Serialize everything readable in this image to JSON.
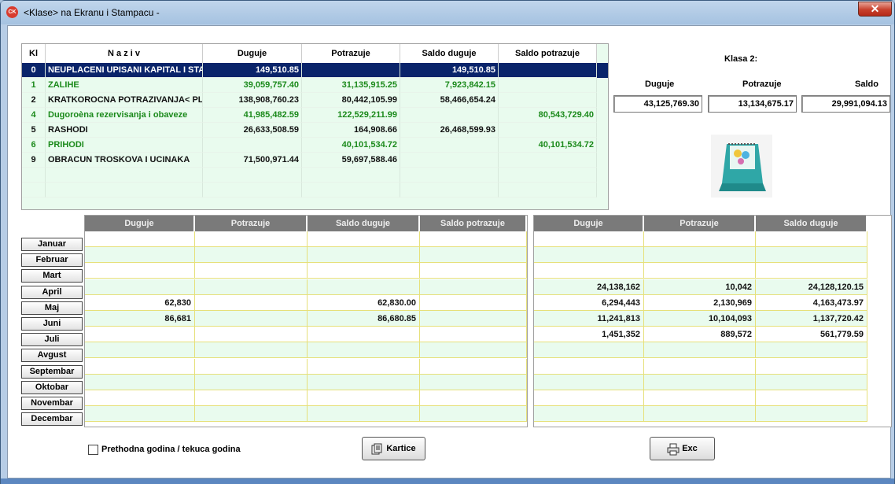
{
  "window": {
    "title": "<Klase> na Ekranu i Stampacu -",
    "icon_text": "CK",
    "close_label": "✕"
  },
  "klase_table": {
    "headers": [
      "Kl",
      "N a z i v",
      "Duguje",
      "Potrazuje",
      "Saldo duguje",
      "Saldo potrazuje"
    ],
    "rows": [
      {
        "kl": "0",
        "naziv": "NEUPLACENI UPISANI KAPITAL I STA",
        "duguje": "149,510.85",
        "potrazuje": "",
        "saldo_duguje": "149,510.85",
        "saldo_potrazuje": "",
        "color": "selected"
      },
      {
        "kl": "1",
        "naziv": "ZALIHE",
        "duguje": "39,059,757.40",
        "potrazuje": "31,135,915.25",
        "saldo_duguje": "7,923,842.15",
        "saldo_potrazuje": "",
        "color": "green"
      },
      {
        "kl": "2",
        "naziv": "KRATKOROCNA POTRAZIVANJA< PL",
        "duguje": "138,908,760.23",
        "potrazuje": "80,442,105.99",
        "saldo_duguje": "58,466,654.24",
        "saldo_potrazuje": "",
        "color": "black"
      },
      {
        "kl": "4",
        "naziv": "Dugoroèna rezervisanja i obaveze",
        "duguje": "41,985,482.59",
        "potrazuje": "122,529,211.99",
        "saldo_duguje": "",
        "saldo_potrazuje": "80,543,729.40",
        "color": "green"
      },
      {
        "kl": "5",
        "naziv": "RASHODI",
        "duguje": "26,633,508.59",
        "potrazuje": "164,908.66",
        "saldo_duguje": "26,468,599.93",
        "saldo_potrazuje": "",
        "color": "black"
      },
      {
        "kl": "6",
        "naziv": "PRIHODI",
        "duguje": "",
        "potrazuje": "40,101,534.72",
        "saldo_duguje": "",
        "saldo_potrazuje": "40,101,534.72",
        "color": "green"
      },
      {
        "kl": "9",
        "naziv": "OBRACUN TROSKOVA I UCINAKA",
        "duguje": "71,500,971.44",
        "potrazuje": "59,697,588.46",
        "saldo_duguje": "",
        "saldo_potrazuje": "",
        "color": "black"
      }
    ]
  },
  "klasa_summary": {
    "title": "Klasa 2:",
    "labels": {
      "duguje": "Duguje",
      "potrazuje": "Potrazuje",
      "saldo": "Saldo"
    },
    "values": {
      "duguje": "43,125,769.30",
      "potrazuje": "13,134,675.17",
      "saldo": "29,991,094.13"
    }
  },
  "months": [
    "Januar",
    "Februar",
    "Mart",
    "April",
    "Maj",
    "Juni",
    "Juli",
    "Avgust",
    "Septembar",
    "Oktobar",
    "Novembar",
    "Decembar"
  ],
  "prev_year_grid": {
    "headers": [
      "Duguje",
      "Potrazuje",
      "Saldo duguje",
      "Saldo potrazuje"
    ],
    "rows": [
      [
        "",
        "",
        "",
        ""
      ],
      [
        "",
        "",
        "",
        ""
      ],
      [
        "",
        "",
        "",
        ""
      ],
      [
        "",
        "",
        "",
        ""
      ],
      [
        "62,830",
        "",
        "62,830.00",
        ""
      ],
      [
        "86,681",
        "",
        "86,680.85",
        ""
      ],
      [
        "",
        "",
        "",
        ""
      ],
      [
        "",
        "",
        "",
        ""
      ],
      [
        "",
        "",
        "",
        ""
      ],
      [
        "",
        "",
        "",
        ""
      ],
      [
        "",
        "",
        "",
        ""
      ],
      [
        "",
        "",
        "",
        ""
      ]
    ]
  },
  "curr_year_grid": {
    "headers": [
      "Duguje",
      "Potrazuje",
      "Saldo duguje"
    ],
    "rows": [
      [
        "",
        "",
        ""
      ],
      [
        "",
        "",
        ""
      ],
      [
        "",
        "",
        ""
      ],
      [
        "24,138,162",
        "10,042",
        "24,128,120.15"
      ],
      [
        "6,294,443",
        "2,130,969",
        "4,163,473.97"
      ],
      [
        "11,241,813",
        "10,104,093",
        "1,137,720.42"
      ],
      [
        "1,451,352",
        "889,572",
        "561,779.59"
      ],
      [
        "",
        "",
        ""
      ],
      [
        "",
        "",
        ""
      ],
      [
        "",
        "",
        ""
      ],
      [
        "",
        "",
        ""
      ],
      [
        "",
        "",
        ""
      ]
    ]
  },
  "checkbox": {
    "label": "Prethodna godina / tekuca godina",
    "checked": false
  },
  "buttons": {
    "kartice": "Kartice",
    "exc": "Exc"
  }
}
